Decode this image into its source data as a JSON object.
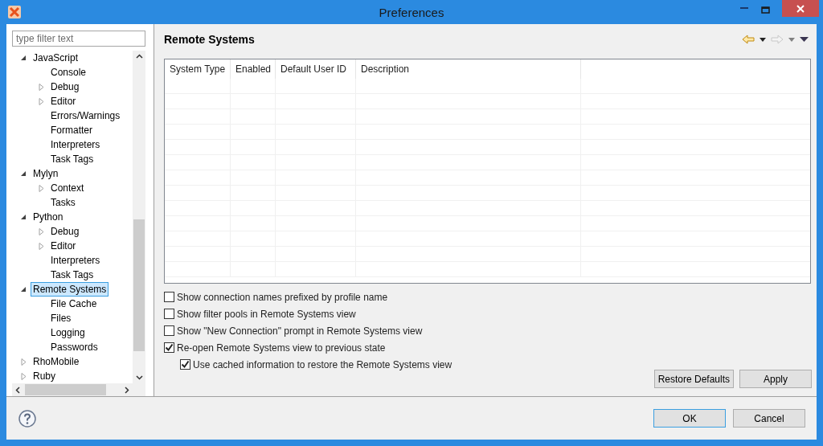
{
  "window": {
    "title": "Preferences"
  },
  "filter": {
    "placeholder": "type filter text"
  },
  "tree": [
    {
      "label": "JavaScript",
      "expanded": true,
      "selected": false,
      "children": [
        {
          "label": "Console",
          "selected": false
        },
        {
          "label": "Debug",
          "expanded": false,
          "selected": false
        },
        {
          "label": "Editor",
          "expanded": false,
          "selected": false
        },
        {
          "label": "Errors/Warnings",
          "selected": false
        },
        {
          "label": "Formatter",
          "selected": false
        },
        {
          "label": "Interpreters",
          "selected": false
        },
        {
          "label": "Task Tags",
          "selected": false
        }
      ]
    },
    {
      "label": "Mylyn",
      "expanded": true,
      "selected": false,
      "children": [
        {
          "label": "Context",
          "expanded": false,
          "selected": false
        },
        {
          "label": "Tasks",
          "selected": false
        }
      ]
    },
    {
      "label": "Python",
      "expanded": true,
      "selected": false,
      "children": [
        {
          "label": "Debug",
          "expanded": false,
          "selected": false
        },
        {
          "label": "Editor",
          "expanded": false,
          "selected": false
        },
        {
          "label": "Interpreters",
          "selected": false
        },
        {
          "label": "Task Tags",
          "selected": false
        }
      ]
    },
    {
      "label": "Remote Systems",
      "expanded": true,
      "selected": true,
      "children": [
        {
          "label": "File Cache",
          "selected": false
        },
        {
          "label": "Files",
          "selected": false
        },
        {
          "label": "Logging",
          "selected": false
        },
        {
          "label": "Passwords",
          "selected": false
        }
      ]
    },
    {
      "label": "RhoMobile",
      "expanded": false,
      "selected": false
    },
    {
      "label": "Ruby",
      "expanded": false,
      "selected": false
    }
  ],
  "page": {
    "title": "Remote Systems"
  },
  "table": {
    "columns": [
      "System Type",
      "Enabled",
      "Default User ID",
      "Description"
    ]
  },
  "options": [
    {
      "label": "Show connection names prefixed by profile name",
      "checked": false
    },
    {
      "label": "Show filter pools in Remote Systems view",
      "checked": false
    },
    {
      "label": "Show \"New Connection\" prompt in Remote Systems view",
      "checked": false
    },
    {
      "label": "Re-open Remote Systems view to previous state",
      "checked": true,
      "children": [
        {
          "label": "Use cached information to restore the Remote Systems view",
          "checked": true
        }
      ]
    }
  ],
  "page_buttons": [
    "Restore Defaults",
    "Apply"
  ],
  "dialog_buttons": [
    {
      "label": "OK",
      "default": true
    },
    {
      "label": "Cancel",
      "default": false
    }
  ]
}
